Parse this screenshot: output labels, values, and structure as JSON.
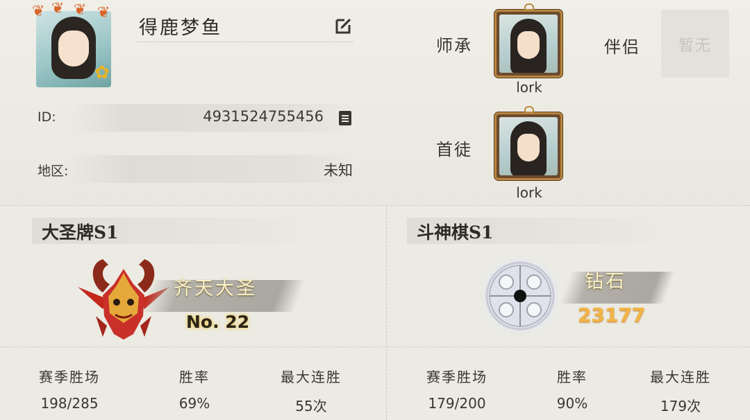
{
  "profile": {
    "name": "得鹿梦鱼",
    "id_label": "ID:",
    "id_value": "4931524755456",
    "region_label": "地区:",
    "region_value": "未知"
  },
  "relations": {
    "master_label": "师承",
    "master_name": "lork",
    "partner_label": "伴侣",
    "partner_value": "暂无",
    "disciple_label": "首徒",
    "disciple_name": "lork"
  },
  "modes": [
    {
      "title": "大圣牌S1",
      "rank_name": "齐天大圣",
      "rank_number": "No. 22",
      "stats": [
        {
          "label": "赛季胜场",
          "value": "198/285"
        },
        {
          "label": "胜率",
          "value": "69%"
        },
        {
          "label": "最大连胜",
          "value": "55次"
        }
      ]
    },
    {
      "title": "斗神棋S1",
      "rank_name": "钻石",
      "rank_score": "23177",
      "stats": [
        {
          "label": "赛季胜场",
          "value": "179/200"
        },
        {
          "label": "胜率",
          "value": "90%"
        },
        {
          "label": "最大连胜",
          "value": "179次"
        }
      ]
    }
  ],
  "icons": {
    "edit": "edit-icon",
    "copy": "copy-icon",
    "monkey_king_emblem": "monkey-king-emblem-icon",
    "diamond_chess_emblem": "diamond-chess-emblem-icon"
  },
  "colors": {
    "background": "#ecebe3",
    "rank_gold": "#f2b445",
    "banner_gray": "#b2b0a8"
  }
}
